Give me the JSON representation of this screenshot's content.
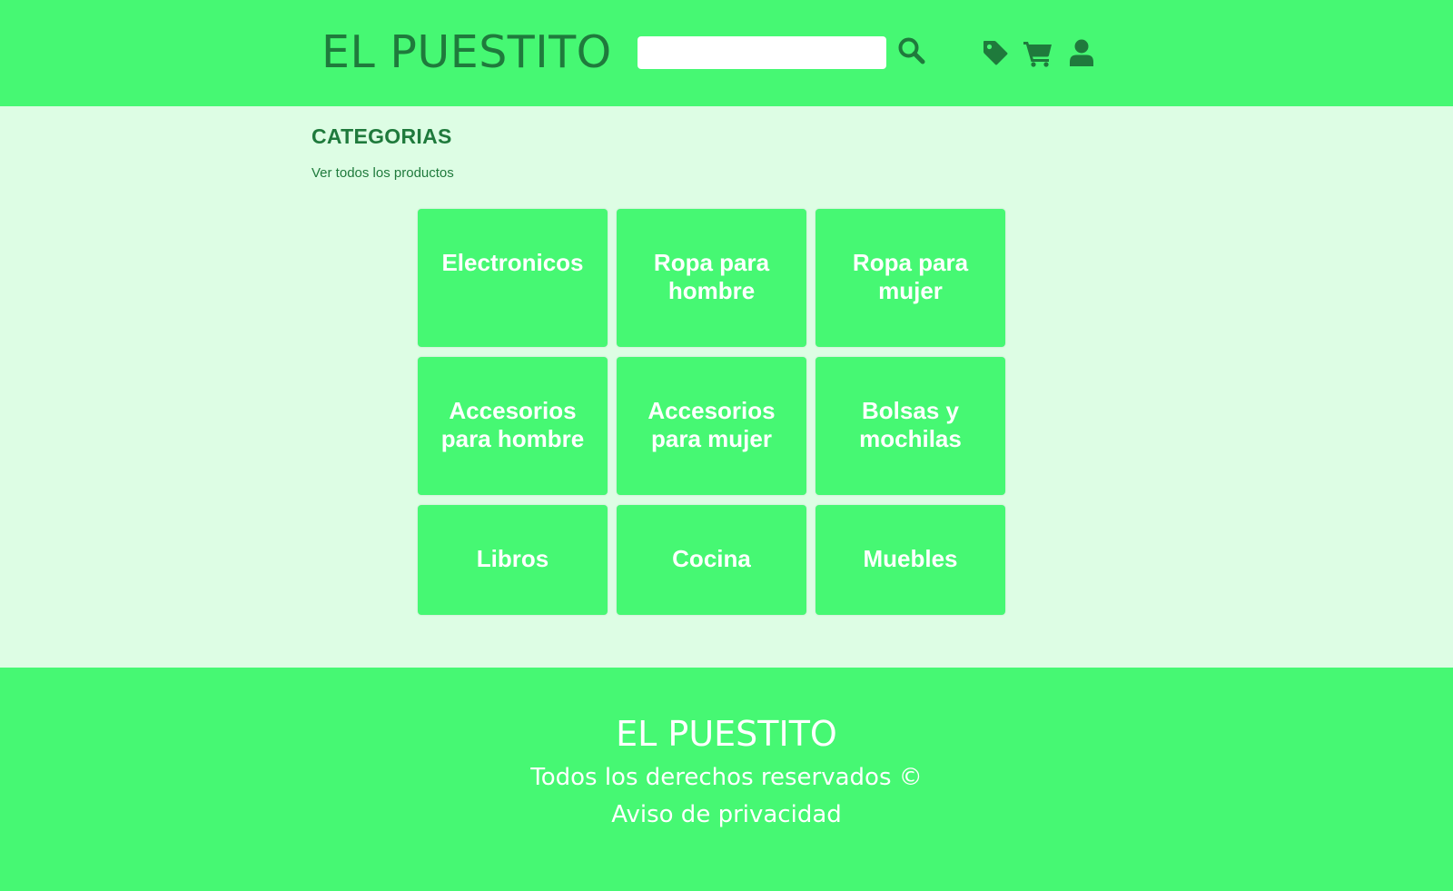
{
  "colors": {
    "brand_green": "#46f873",
    "dark_green": "#1f7a3c",
    "page_background": "#ddfde4",
    "card_text": "#ffffff"
  },
  "header": {
    "logo": "EL PUESTITO",
    "search": {
      "value": "",
      "placeholder": ""
    },
    "icons": [
      "search-icon",
      "tag-icon",
      "cart-icon",
      "user-icon"
    ]
  },
  "main": {
    "section_title": "CATEGORIAS",
    "view_all_link": "Ver todos los productos",
    "categories": [
      {
        "label": "Electronicos"
      },
      {
        "label": "Ropa para hombre"
      },
      {
        "label": "Ropa para mujer"
      },
      {
        "label": "Accesorios para hombre"
      },
      {
        "label": "Accesorios para mujer"
      },
      {
        "label": "Bolsas y mochilas"
      },
      {
        "label": "Libros"
      },
      {
        "label": "Cocina"
      },
      {
        "label": "Muebles"
      }
    ]
  },
  "footer": {
    "title": "EL PUESTITO",
    "rights": "Todos los derechos reservados ©",
    "privacy": "Aviso de privacidad"
  }
}
